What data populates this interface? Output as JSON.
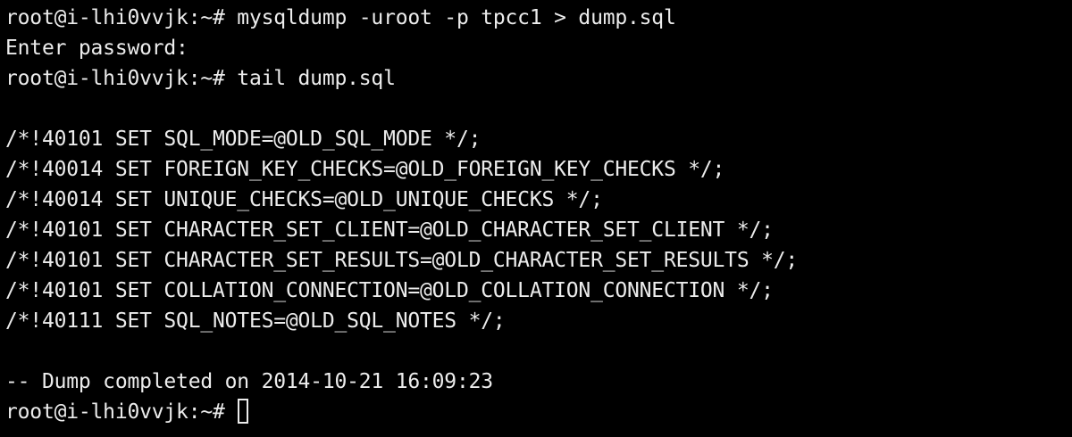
{
  "terminal": {
    "prompt": "root@i-lhi0vvjk:~# ",
    "command_1": "mysqldump -uroot -p tpcc1 > dump.sql",
    "password_prompt": "Enter password:",
    "command_2": "tail dump.sql",
    "output_lines": [
      "/*!40101 SET SQL_MODE=@OLD_SQL_MODE */;",
      "/*!40014 SET FOREIGN_KEY_CHECKS=@OLD_FOREIGN_KEY_CHECKS */;",
      "/*!40014 SET UNIQUE_CHECKS=@OLD_UNIQUE_CHECKS */;",
      "/*!40101 SET CHARACTER_SET_CLIENT=@OLD_CHARACTER_SET_CLIENT */;",
      "/*!40101 SET CHARACTER_SET_RESULTS=@OLD_CHARACTER_SET_RESULTS */;",
      "/*!40101 SET COLLATION_CONNECTION=@OLD_COLLATION_CONNECTION */;",
      "/*!40111 SET SQL_NOTES=@OLD_SQL_NOTES */;"
    ],
    "dump_completed": "-- Dump completed on 2014-10-21 16:09:23",
    "colors": {
      "background": "#000000",
      "foreground": "#ececec"
    }
  }
}
